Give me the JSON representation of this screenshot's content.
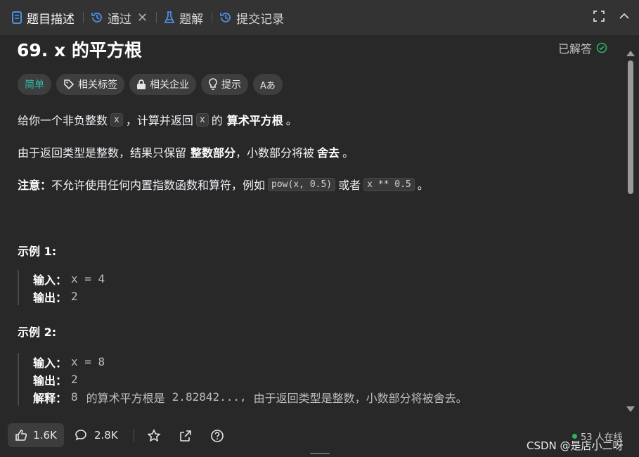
{
  "tabs": [
    {
      "label": "题目描述",
      "icon": "document-icon"
    },
    {
      "label": "通过",
      "icon": "history-icon"
    },
    {
      "label": "题解",
      "icon": "flask-icon"
    },
    {
      "label": "提交记录",
      "icon": "history-icon"
    }
  ],
  "problem": {
    "title": "69. x 的平方根",
    "status": "已解答",
    "tags": {
      "difficulty": "简单",
      "related_tags": "相关标签",
      "related_companies": "相关企业",
      "hint": "提示",
      "font": "Aあ"
    },
    "para1": {
      "a": "给你一个非负整数",
      "code": "x",
      "b": "，计算并返回",
      "code2": "x",
      "c": "的",
      "bold": "算术平方根",
      "d": "。"
    },
    "para2": {
      "a": "由于返回类型是整数，结果只保留",
      "bold": "整数部分",
      "b": "，小数部分将被",
      "bold2": "舍去",
      "c": "。"
    },
    "para3": {
      "bold": "注意：",
      "a": "不允许使用任何内置指数函数和算符，例如",
      "code": "pow(x, 0.5)",
      "b": "或者",
      "code2": "x ** 0.5",
      "c": "。"
    },
    "example1": {
      "title": "示例 1:",
      "input_label": "输入：",
      "input": "x = 4",
      "output_label": "输出：",
      "output": "2"
    },
    "example2": {
      "title": "示例 2:",
      "input_label": "输入：",
      "input": "x = 8",
      "output_label": "输出：",
      "output": "2",
      "explain_label": "解释：",
      "explain_code": "8",
      "explain_a": "的算术平方根是",
      "explain_code2": "2.82842...,",
      "explain_b": "由于返回类型是整数，小数部分将被舍去。"
    }
  },
  "footer": {
    "likes": "1.6K",
    "comments": "2.8K",
    "online": "53 人在线",
    "watermark": "CSDN @是店小二呀"
  },
  "colors": {
    "easy": "#2cbbaa",
    "solved_check": "#2db55d",
    "online_dot": "#2db55d"
  }
}
